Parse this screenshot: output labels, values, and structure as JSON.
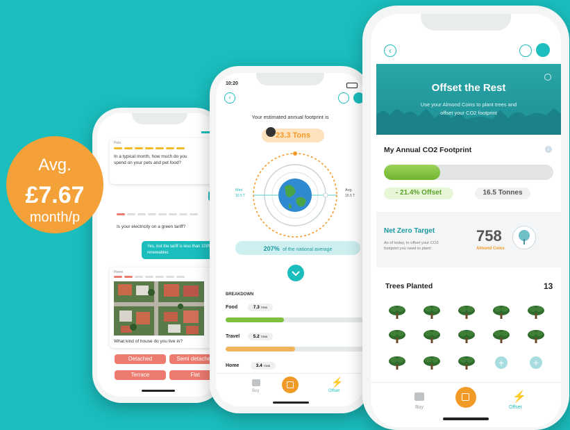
{
  "badge": {
    "line1": "Avg.",
    "amount": "£7.67",
    "line3": "month/p"
  },
  "phone1": {
    "q1_tag": "Pets",
    "q1_text": "In a typical month, how much do you spend on your pets and pet food?",
    "q2_text": "Is your electricity on a green tariff?",
    "a2_text": "Yes, but the tariff is less than 100% renewables",
    "q3_tag": "Home",
    "q3_text": "What kind of house do you live in?",
    "options": [
      "Detached",
      "Semi detached",
      "Terrace",
      "Flat"
    ]
  },
  "phone2": {
    "time": "10:20",
    "heading": "Your estimated annual footprint is",
    "total": "23.3 Tons",
    "min_label": "Mini",
    "min_value": "10.5 T",
    "avg_label": "Avg.",
    "avg_value": "15.5 T",
    "national_pct": "207%",
    "national_text": "of the national average",
    "breakdown_title": "BREAKDOWN",
    "breakdown": [
      {
        "label": "Food",
        "value": "7.3",
        "unit": "TONS",
        "fill": 0.42,
        "color": "#7fbf3f"
      },
      {
        "label": "Travel",
        "value": "5.2",
        "unit": "TONS",
        "fill": 0.5,
        "color": "#f0b45a"
      },
      {
        "label": "Home",
        "value": "3.4",
        "unit": "TONS"
      }
    ],
    "nav": {
      "buy": "Buy",
      "offset": "Offset"
    }
  },
  "phone3": {
    "banner_title": "Offset the Rest",
    "banner_sub1": "Use your Almond Coins to plant trees and",
    "banner_sub2": "offset your CO2 footprint",
    "footprint_title": "My Annual CO2 Footprint",
    "footprint_fill": 0.33,
    "offset_pct": "- 21.4% Offset",
    "tonnes": "16.5 Tonnes",
    "nz_title": "Net Zero Target",
    "nz_desc1": "As of today, to offset your CO2",
    "nz_desc2": "footprint you need to plant:",
    "nz_value": "758",
    "nz_unit": "Almond Coins",
    "trees_title": "Trees Planted",
    "trees_count": "13",
    "nav": {
      "buy": "Buy",
      "offset": "Offset"
    }
  },
  "colors": {
    "teal": "#1bbdbd",
    "orange": "#f5a13a",
    "green": "#7fc242",
    "salmon": "#ee7b6f"
  }
}
